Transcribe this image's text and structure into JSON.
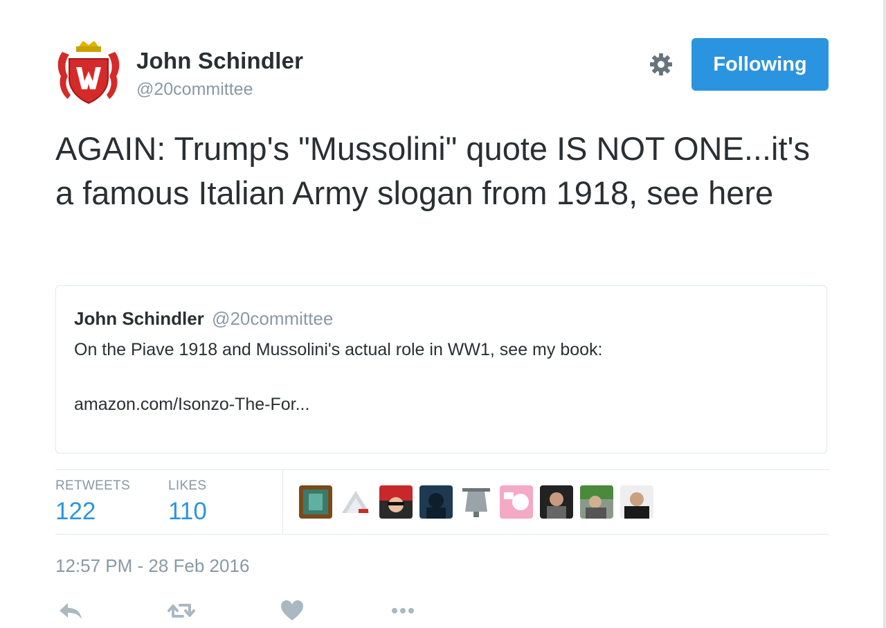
{
  "user": {
    "name": "John Schindler",
    "handle": "@20committee"
  },
  "header": {
    "follow_label": "Following"
  },
  "icons": {
    "gear": "gear-icon",
    "reply": "reply-icon",
    "retweet": "retweet-icon",
    "like": "heart-icon",
    "more": "more-icon"
  },
  "colors": {
    "accent": "#2b94e0",
    "muted": "#8899a6",
    "text": "#292f33"
  },
  "tweet": {
    "text": "AGAIN: Trump's \"Mussolini\" quote IS NOT ONE...it's a famous Italian Army slogan from 1918, see here",
    "timestamp": "12:57 PM - 28 Feb 2016"
  },
  "quoted": {
    "name": "John Schindler",
    "handle": "@20committee",
    "text": "On the Piave 1918 and Mussolini's actual role in WW1, see my book:",
    "link": "amazon.com/Isonzo-The-For..."
  },
  "stats": {
    "retweets_label": "RETWEETS",
    "retweets_value": "122",
    "likes_label": "LIKES",
    "likes_value": "110"
  }
}
